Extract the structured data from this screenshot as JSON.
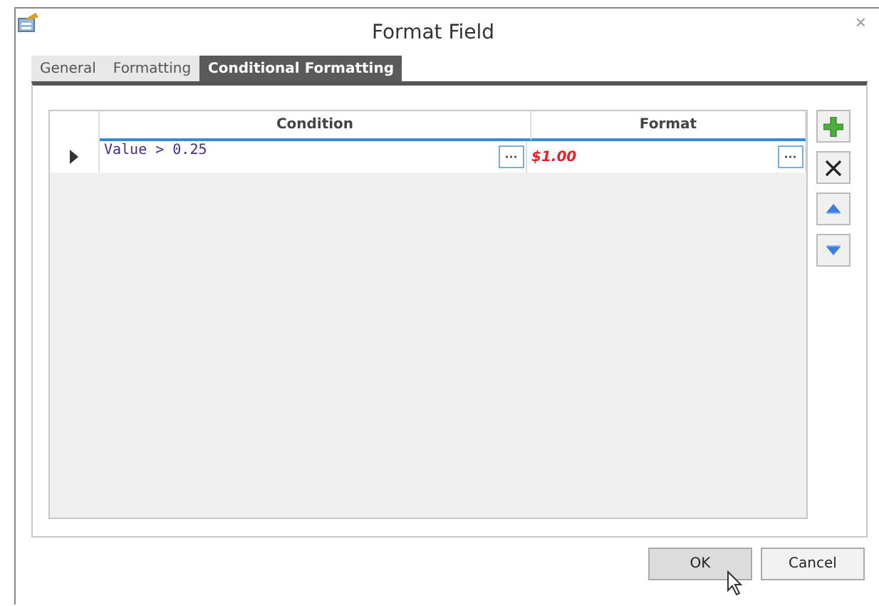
{
  "window": {
    "title": "Format Field",
    "close": "×"
  },
  "tabs": [
    {
      "label": "General",
      "selected": false
    },
    {
      "label": "Formatting",
      "selected": false
    },
    {
      "label": "Conditional Formatting",
      "selected": true
    }
  ],
  "grid": {
    "columns": [
      "Condition",
      "Format"
    ],
    "rows": [
      {
        "selected": true,
        "condition": "Value > 0.25",
        "format": "$1.00",
        "condition_button": "···",
        "format_button": "···"
      }
    ]
  },
  "buttons": [
    {
      "label": "OK",
      "hovered": true
    },
    {
      "label": "Cancel",
      "hovered": false
    }
  ]
}
